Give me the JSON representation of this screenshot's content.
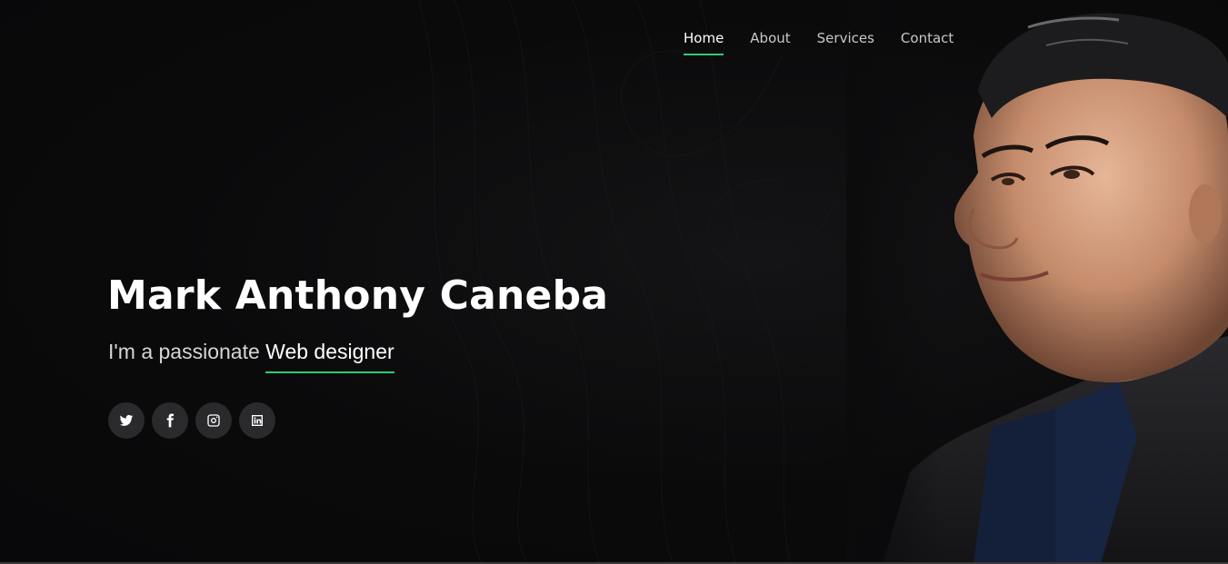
{
  "nav": {
    "items": [
      {
        "label": "Home",
        "active": true
      },
      {
        "label": "About",
        "active": false
      },
      {
        "label": "Services",
        "active": false
      },
      {
        "label": "Contact",
        "active": false
      }
    ]
  },
  "hero": {
    "name": "Mark Anthony Caneba",
    "tagline_prefix": "I'm a passionate ",
    "role": "Web designer"
  },
  "social": [
    {
      "icon": "twitter-icon"
    },
    {
      "icon": "facebook-icon"
    },
    {
      "icon": "instagram-icon"
    },
    {
      "icon": "linkedin-icon"
    }
  ],
  "colors": {
    "accent": "#2ecc71",
    "background": "#0b0b0c",
    "social_bg": "#2a2a2c"
  }
}
